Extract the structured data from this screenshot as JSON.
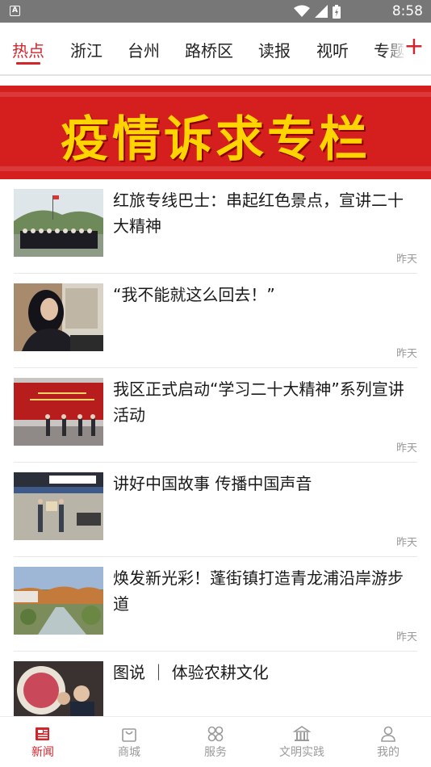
{
  "status_bar": {
    "indicator": "A",
    "time": "8:58",
    "icons": [
      "wifi-icon",
      "signal-icon",
      "battery-icon"
    ]
  },
  "tabs": [
    {
      "label": "热点",
      "active": true
    },
    {
      "label": "浙江",
      "active": false
    },
    {
      "label": "台州",
      "active": false
    },
    {
      "label": "路桥区",
      "active": false
    },
    {
      "label": "读报",
      "active": false
    },
    {
      "label": "视听",
      "active": false
    },
    {
      "label": "专题",
      "active": false
    }
  ],
  "add_channel_label": "+",
  "banner": {
    "text": "疫情诉求专栏"
  },
  "news": [
    {
      "title": "红旅专线巴士：串起红色景点，宣讲二十大精神",
      "time": "昨天"
    },
    {
      "title": "“我不能就这么回去！”",
      "time": "昨天"
    },
    {
      "title": "我区正式启动“学习二十大精神”系列宣讲活动",
      "time": "昨天"
    },
    {
      "title": "讲好中国故事 传播中国声音",
      "time": "昨天"
    },
    {
      "title": "焕发新光彩！蓬街镇打造青龙浦沿岸游步道",
      "time": "昨天"
    },
    {
      "title": "图说 ｜ 体验农耕文化",
      "time": ""
    }
  ],
  "bottom_nav": [
    {
      "label": "新闻",
      "icon": "newspaper-icon",
      "active": true
    },
    {
      "label": "商城",
      "icon": "shopping-bag-icon",
      "active": false
    },
    {
      "label": "服务",
      "icon": "grid-circles-icon",
      "active": false
    },
    {
      "label": "文明实践",
      "icon": "building-icon",
      "active": false
    },
    {
      "label": "我的",
      "icon": "person-icon",
      "active": false
    }
  ],
  "colors": {
    "accent": "#d3242b",
    "status_bar": "#777777",
    "banner_bg": "#d51f1f",
    "banner_text": "#ffd400"
  }
}
